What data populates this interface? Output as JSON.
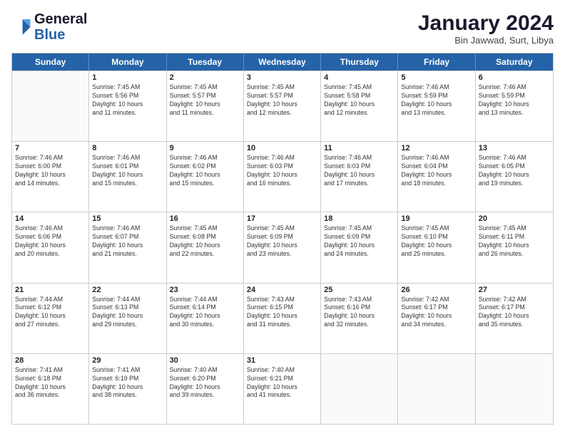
{
  "logo": {
    "line1": "General",
    "line2": "Blue"
  },
  "title": "January 2024",
  "location": "Bin Jawwad, Surt, Libya",
  "days_of_week": [
    "Sunday",
    "Monday",
    "Tuesday",
    "Wednesday",
    "Thursday",
    "Friday",
    "Saturday"
  ],
  "weeks": [
    [
      {
        "day": "",
        "info": ""
      },
      {
        "day": "1",
        "info": "Sunrise: 7:45 AM\nSunset: 5:56 PM\nDaylight: 10 hours\nand 11 minutes."
      },
      {
        "day": "2",
        "info": "Sunrise: 7:45 AM\nSunset: 5:57 PM\nDaylight: 10 hours\nand 11 minutes."
      },
      {
        "day": "3",
        "info": "Sunrise: 7:45 AM\nSunset: 5:57 PM\nDaylight: 10 hours\nand 12 minutes."
      },
      {
        "day": "4",
        "info": "Sunrise: 7:45 AM\nSunset: 5:58 PM\nDaylight: 10 hours\nand 12 minutes."
      },
      {
        "day": "5",
        "info": "Sunrise: 7:46 AM\nSunset: 5:59 PM\nDaylight: 10 hours\nand 13 minutes."
      },
      {
        "day": "6",
        "info": "Sunrise: 7:46 AM\nSunset: 5:59 PM\nDaylight: 10 hours\nand 13 minutes."
      }
    ],
    [
      {
        "day": "7",
        "info": "Sunrise: 7:46 AM\nSunset: 6:00 PM\nDaylight: 10 hours\nand 14 minutes."
      },
      {
        "day": "8",
        "info": "Sunrise: 7:46 AM\nSunset: 6:01 PM\nDaylight: 10 hours\nand 15 minutes."
      },
      {
        "day": "9",
        "info": "Sunrise: 7:46 AM\nSunset: 6:02 PM\nDaylight: 10 hours\nand 15 minutes."
      },
      {
        "day": "10",
        "info": "Sunrise: 7:46 AM\nSunset: 6:03 PM\nDaylight: 10 hours\nand 16 minutes."
      },
      {
        "day": "11",
        "info": "Sunrise: 7:46 AM\nSunset: 6:03 PM\nDaylight: 10 hours\nand 17 minutes."
      },
      {
        "day": "12",
        "info": "Sunrise: 7:46 AM\nSunset: 6:04 PM\nDaylight: 10 hours\nand 18 minutes."
      },
      {
        "day": "13",
        "info": "Sunrise: 7:46 AM\nSunset: 6:05 PM\nDaylight: 10 hours\nand 19 minutes."
      }
    ],
    [
      {
        "day": "14",
        "info": "Sunrise: 7:46 AM\nSunset: 6:06 PM\nDaylight: 10 hours\nand 20 minutes."
      },
      {
        "day": "15",
        "info": "Sunrise: 7:46 AM\nSunset: 6:07 PM\nDaylight: 10 hours\nand 21 minutes."
      },
      {
        "day": "16",
        "info": "Sunrise: 7:45 AM\nSunset: 6:08 PM\nDaylight: 10 hours\nand 22 minutes."
      },
      {
        "day": "17",
        "info": "Sunrise: 7:45 AM\nSunset: 6:09 PM\nDaylight: 10 hours\nand 23 minutes."
      },
      {
        "day": "18",
        "info": "Sunrise: 7:45 AM\nSunset: 6:09 PM\nDaylight: 10 hours\nand 24 minutes."
      },
      {
        "day": "19",
        "info": "Sunrise: 7:45 AM\nSunset: 6:10 PM\nDaylight: 10 hours\nand 25 minutes."
      },
      {
        "day": "20",
        "info": "Sunrise: 7:45 AM\nSunset: 6:11 PM\nDaylight: 10 hours\nand 26 minutes."
      }
    ],
    [
      {
        "day": "21",
        "info": "Sunrise: 7:44 AM\nSunset: 6:12 PM\nDaylight: 10 hours\nand 27 minutes."
      },
      {
        "day": "22",
        "info": "Sunrise: 7:44 AM\nSunset: 6:13 PM\nDaylight: 10 hours\nand 29 minutes."
      },
      {
        "day": "23",
        "info": "Sunrise: 7:44 AM\nSunset: 6:14 PM\nDaylight: 10 hours\nand 30 minutes."
      },
      {
        "day": "24",
        "info": "Sunrise: 7:43 AM\nSunset: 6:15 PM\nDaylight: 10 hours\nand 31 minutes."
      },
      {
        "day": "25",
        "info": "Sunrise: 7:43 AM\nSunset: 6:16 PM\nDaylight: 10 hours\nand 32 minutes."
      },
      {
        "day": "26",
        "info": "Sunrise: 7:42 AM\nSunset: 6:17 PM\nDaylight: 10 hours\nand 34 minutes."
      },
      {
        "day": "27",
        "info": "Sunrise: 7:42 AM\nSunset: 6:17 PM\nDaylight: 10 hours\nand 35 minutes."
      }
    ],
    [
      {
        "day": "28",
        "info": "Sunrise: 7:41 AM\nSunset: 6:18 PM\nDaylight: 10 hours\nand 36 minutes."
      },
      {
        "day": "29",
        "info": "Sunrise: 7:41 AM\nSunset: 6:19 PM\nDaylight: 10 hours\nand 38 minutes."
      },
      {
        "day": "30",
        "info": "Sunrise: 7:40 AM\nSunset: 6:20 PM\nDaylight: 10 hours\nand 39 minutes."
      },
      {
        "day": "31",
        "info": "Sunrise: 7:40 AM\nSunset: 6:21 PM\nDaylight: 10 hours\nand 41 minutes."
      },
      {
        "day": "",
        "info": ""
      },
      {
        "day": "",
        "info": ""
      },
      {
        "day": "",
        "info": ""
      }
    ]
  ]
}
